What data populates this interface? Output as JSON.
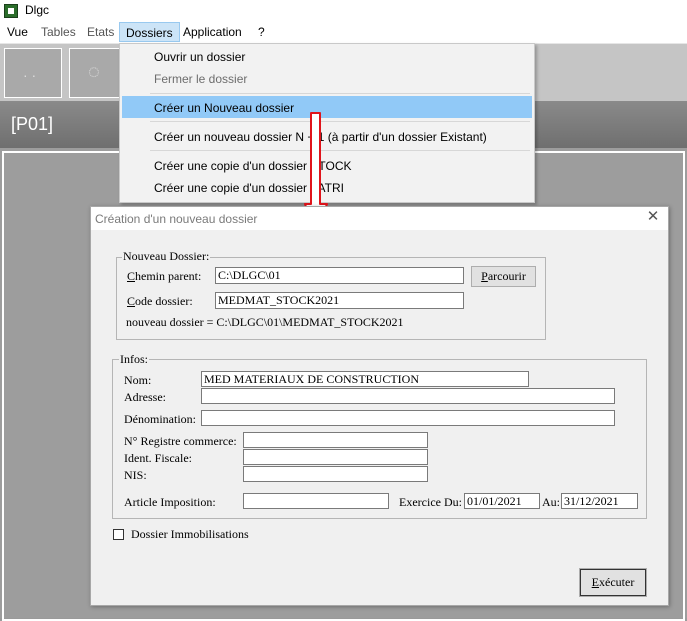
{
  "window": {
    "title": "Dlgc"
  },
  "menubar": {
    "vue": "Vue",
    "tables": "Tables",
    "etats": "Etats",
    "dossiers": "Dossiers",
    "application": "Application",
    "help": "?"
  },
  "code_band": {
    "code": "[P01]"
  },
  "dropdown": {
    "items": [
      {
        "label": "Ouvrir un dossier",
        "enabled": true
      },
      {
        "label": "Fermer le dossier",
        "enabled": false
      },
      {
        "label": "Créer un Nouveau dossier",
        "enabled": true,
        "highlighted": true
      },
      {
        "label": "Créer un nouveau dossier N + 1 (à partir d'un dossier Existant)",
        "enabled": true
      },
      {
        "label": "Créer une copie d'un dossier STOCK",
        "enabled": true
      },
      {
        "label": "Créer une copie d'un dossier PATRI",
        "enabled": true
      }
    ]
  },
  "dialog": {
    "title": "Création d'un nouveau dossier",
    "nouveau": {
      "group_label": "Nouveau Dossier:",
      "chemin_label_first": "C",
      "chemin_label_rest": "hemin parent:",
      "chemin_value": "C:\\DLGC\\01",
      "parcourir_first": "P",
      "parcourir_rest": "arcourir",
      "code_label_first": "C",
      "code_label_rest": "ode dossier:",
      "code_value": "MEDMAT_STOCK2021",
      "result_text": "nouveau dossier = C:\\DLGC\\01\\MEDMAT_STOCK2021"
    },
    "infos": {
      "group_label": "Infos:",
      "nom_label": "Nom:",
      "nom_value": "MED MATERIAUX DE CONSTRUCTION",
      "adresse_label": "Adresse:",
      "adresse_value": "",
      "denomination_label": "Dénomination:",
      "denomination_value": "",
      "registre_label": "N° Registre commerce:",
      "registre_value": "",
      "ident_label": "Ident. Fiscale:",
      "ident_value": "",
      "nis_label": "NIS:",
      "nis_value": "",
      "article_label": "Article Imposition:",
      "article_value": "",
      "exercice_label": "Exercice Du:",
      "exercice_du": "01/01/2021",
      "au_label": "Au:",
      "exercice_au": "31/12/2021"
    },
    "immobilisations_label": "Dossier Immobilisations",
    "immobilisations_checked": false,
    "executer_first": "E",
    "executer_rest": "xécuter"
  },
  "colors": {
    "menu_highlight": "#91c9f7",
    "arrow": "#e0141b",
    "code_band": "#7d7d7d"
  }
}
